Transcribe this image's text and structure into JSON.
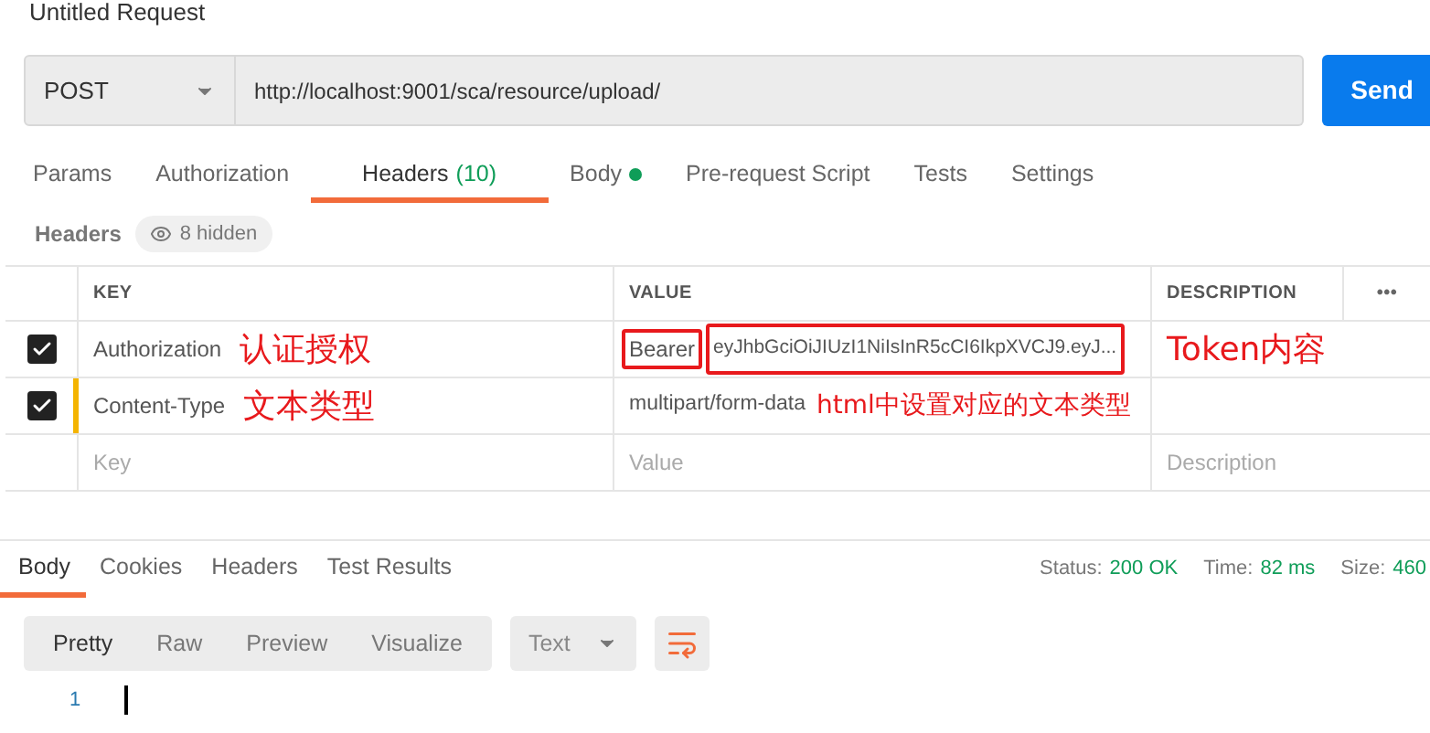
{
  "request": {
    "title": "Untitled Request",
    "method": "POST",
    "url": "http://localhost:9001/sca/resource/upload/",
    "send": "Send"
  },
  "tabs": [
    {
      "label": "Params",
      "selected": false
    },
    {
      "label": "Authorization",
      "selected": false
    },
    {
      "label": "Headers",
      "count": "(10)",
      "selected": true
    },
    {
      "label": "Body",
      "dot": true,
      "selected": false
    },
    {
      "label": "Pre-request Script",
      "selected": false
    },
    {
      "label": "Tests",
      "selected": false
    },
    {
      "label": "Settings",
      "selected": false
    }
  ],
  "headers_bar": {
    "label": "Headers",
    "hidden": "8 hidden"
  },
  "table": {
    "columns": [
      "KEY",
      "VALUE",
      "DESCRIPTION"
    ],
    "more": "•••",
    "rows": [
      {
        "checked": true,
        "key": "Authorization",
        "value_prefix": "Bearer",
        "value": "eyJhbGciOiJIUzI1NiIsInR5cCI6IkpXVCJ9.eyJ...",
        "key_note": "认证授权",
        "value_note": "Token内容",
        "edited": false
      },
      {
        "checked": true,
        "key": "Content-Type",
        "value": "multipart/form-data",
        "key_note": "文本类型",
        "value_note": "html中设置对应的文本类型",
        "edited": true
      }
    ],
    "new_row": {
      "key": {
        "placeholder": "Key"
      },
      "value": {
        "placeholder": "Value"
      },
      "description": {
        "placeholder": "Description"
      }
    }
  },
  "response": {
    "tabs": [
      {
        "label": "Body",
        "selected": true
      },
      {
        "label": "Cookies",
        "selected": false
      },
      {
        "label": "Headers",
        "selected": false
      },
      {
        "label": "Test Results",
        "selected": false
      }
    ],
    "status": [
      {
        "label": "Status:",
        "value": "200 OK"
      },
      {
        "label": "Time:",
        "value": "82 ms"
      },
      {
        "label": "Size:",
        "value": "460"
      }
    ],
    "views": [
      {
        "label": "Pretty",
        "selected": true
      },
      {
        "label": "Raw",
        "selected": false
      },
      {
        "label": "Preview",
        "selected": false
      },
      {
        "label": "Visualize",
        "selected": false
      }
    ],
    "format": "Text",
    "line_number": "1"
  }
}
